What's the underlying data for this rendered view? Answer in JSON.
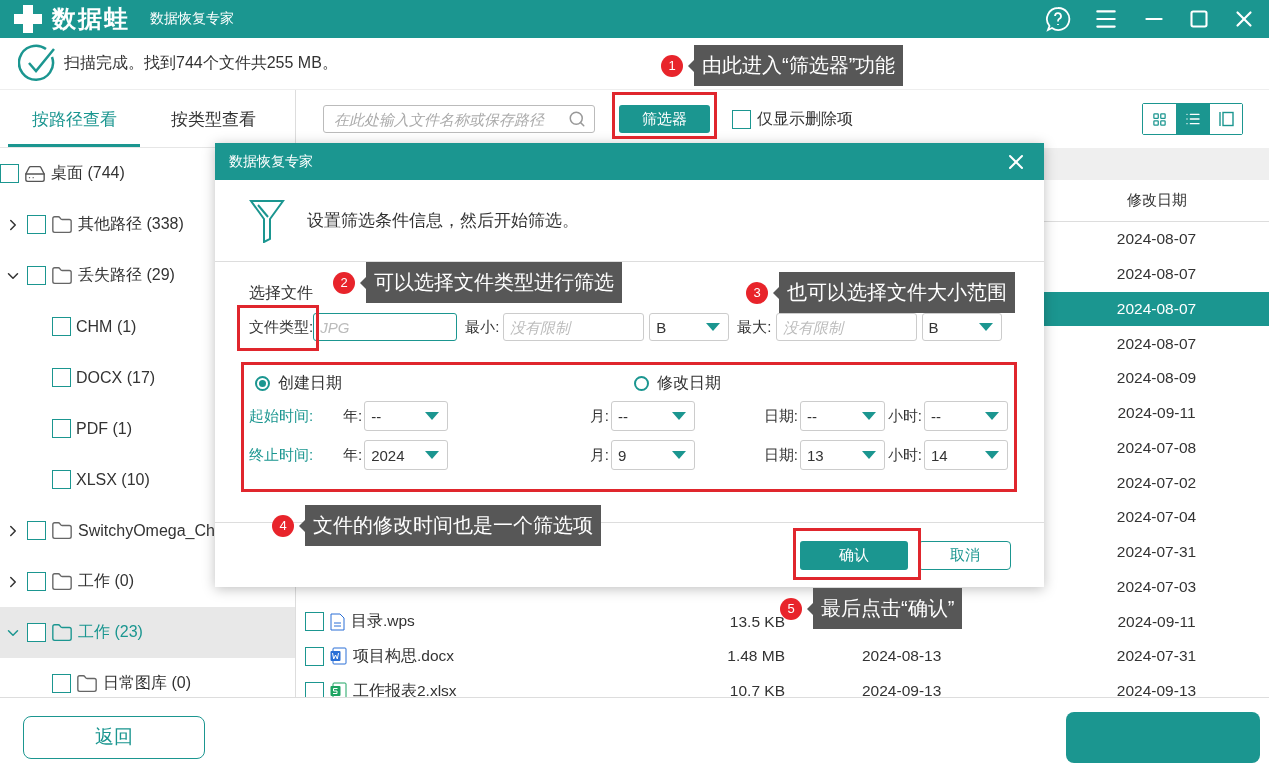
{
  "app": {
    "brand": "数据蛙",
    "title": "数据恢复专家"
  },
  "status": "扫描完成。找到744个文件共255 MB。",
  "view_tabs": [
    {
      "label": "按路径查看",
      "selected": true
    },
    {
      "label": "按类型查看",
      "selected": false
    }
  ],
  "tree": [
    {
      "label": "桌面 (744)",
      "kind": "drive",
      "checked": false,
      "selected": false,
      "children": [
        {
          "label": "其他路径 (338)",
          "kind": "folder",
          "checked": false,
          "selected": false,
          "expanded": false
        },
        {
          "label": "丢失路径 (29)",
          "kind": "folder",
          "checked": false,
          "selected": false,
          "expanded": true,
          "children": [
            {
              "label": "CHM (1)",
              "kind": "type",
              "checked": false,
              "selected": false
            },
            {
              "label": "DOCX (17)",
              "kind": "type",
              "checked": false,
              "selected": false
            },
            {
              "label": "PDF (1)",
              "kind": "type",
              "checked": false,
              "selected": false
            },
            {
              "label": "XLSX (10)",
              "kind": "type",
              "checked": false,
              "selected": false
            }
          ]
        },
        {
          "label": "SwitchyOmega_Ch",
          "kind": "folder",
          "checked": false,
          "selected": false,
          "expanded": false
        },
        {
          "label": "工作 (0)",
          "kind": "folder",
          "checked": false,
          "selected": false,
          "expanded": false
        },
        {
          "label": "工作 (23)",
          "kind": "folder",
          "checked": false,
          "selected": true,
          "expanded": true,
          "children": [
            {
              "label": "日常图库 (0)",
              "kind": "folder",
              "checked": false,
              "selected": false
            }
          ]
        }
      ]
    }
  ],
  "toolbar": {
    "search_placeholder": "在此处输入文件名称或保存路径",
    "filter_button": "筛选器",
    "deleted_only": {
      "label": "仅显示删除项",
      "checked": false
    },
    "view_modes": [
      {
        "kind": "grid",
        "selected": false
      },
      {
        "kind": "list",
        "selected": true
      },
      {
        "kind": "preview",
        "selected": false
      }
    ]
  },
  "table": {
    "modified_header": "修改日期",
    "rows": [
      {
        "modified": "2024-08-07",
        "selected": false
      },
      {
        "modified": "2024-08-07",
        "selected": false
      },
      {
        "modified": "2024-08-07",
        "selected": true
      },
      {
        "modified": "2024-08-07",
        "selected": false
      },
      {
        "modified": "2024-08-09",
        "selected": false
      },
      {
        "modified": "2024-09-11",
        "selected": false
      },
      {
        "modified": "2024-07-08",
        "selected": false
      },
      {
        "modified": "2024-07-02",
        "selected": false
      },
      {
        "modified": "2024-07-04",
        "selected": false
      },
      {
        "modified": "2024-07-31",
        "selected": false
      },
      {
        "modified": "2024-07-03",
        "selected": false
      },
      {
        "name": "目录.wps",
        "kind": "doc",
        "size": "13.5 KB",
        "modified": "2024-09-11",
        "selected": false,
        "checked": false
      },
      {
        "name": "项目构思.docx",
        "kind": "word",
        "size": "1.48 MB",
        "created": "2024-08-13",
        "modified": "2024-07-31",
        "selected": false,
        "checked": false
      },
      {
        "name": "工作报表2.xlsx",
        "kind": "sheet",
        "size": "10.7 KB",
        "created": "2024-09-13",
        "modified": "2024-09-13",
        "selected": false,
        "checked": false
      }
    ]
  },
  "dialog": {
    "title": "数据恢复专家",
    "intro": "设置筛选条件信息，然后开始筛选。",
    "section": "选择文件",
    "type_label": "文件类型:",
    "type_placeholder": "JPG",
    "min_label": "最小:",
    "min_placeholder": "没有限制",
    "min_unit": "B",
    "max_label": "最大:",
    "max_placeholder": "没有限制",
    "max_unit": "B",
    "date_modes": [
      {
        "label": "创建日期",
        "selected": true
      },
      {
        "label": "修改日期",
        "selected": false
      }
    ],
    "ranges": [
      {
        "label": "起始时间:",
        "fields": [
          {
            "label": "年:",
            "value": "--"
          },
          {
            "label": "月:",
            "value": "--"
          },
          {
            "label": "日期:",
            "value": "--"
          },
          {
            "label": "小时:",
            "value": "--"
          }
        ]
      },
      {
        "label": "终止时间:",
        "fields": [
          {
            "label": "年:",
            "value": "2024"
          },
          {
            "label": "月:",
            "value": "9"
          },
          {
            "label": "日期:",
            "value": "13"
          },
          {
            "label": "小时:",
            "value": "14"
          }
        ]
      }
    ],
    "confirm": "确认",
    "cancel": "取消"
  },
  "bottom": {
    "back": "返回"
  },
  "annotations": [
    {
      "number": "1",
      "text": "由此进入“筛选器”功能"
    },
    {
      "number": "2",
      "text": "可以选择文件类型进行筛选"
    },
    {
      "number": "3",
      "text": "也可以选择文件大小范围"
    },
    {
      "number": "4",
      "text": "文件的修改时间也是一个筛选项"
    },
    {
      "number": "5",
      "text": "最后点击“确认”"
    }
  ]
}
